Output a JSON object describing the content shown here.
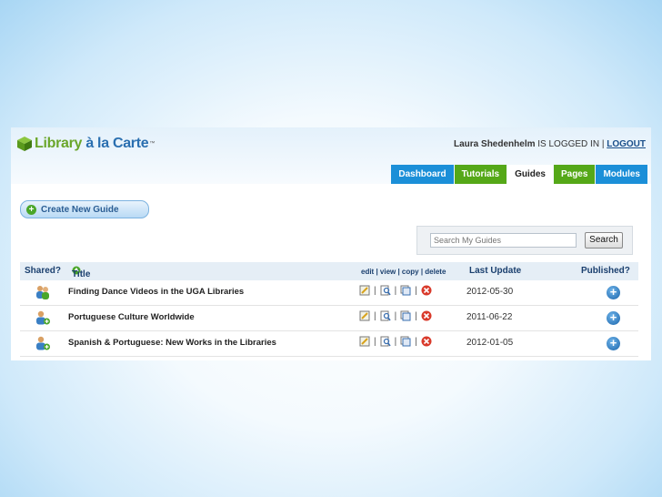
{
  "app": {
    "logo_text_1": "Library",
    "logo_text_2": "à la Carte",
    "logo_tm": "™",
    "user_name": "Laura Shedenhelm",
    "logged_in_text": "IS LOGGED IN |",
    "logout": "LOGOUT"
  },
  "tabs": [
    {
      "label": "Dashboard",
      "color": "#1b8fd8",
      "active": false
    },
    {
      "label": "Tutorials",
      "color": "#55a818",
      "active": false
    },
    {
      "label": "Guides",
      "color": "#ffffff",
      "active": true
    },
    {
      "label": "Pages",
      "color": "#55a818",
      "active": false
    },
    {
      "label": "Modules",
      "color": "#1b8fd8",
      "active": false
    }
  ],
  "create_button": {
    "label": "Create New Guide",
    "icon": "plus-circle-icon"
  },
  "search": {
    "placeholder": "Search My Guides",
    "button": "Search"
  },
  "table": {
    "headers": {
      "shared": "Shared?",
      "title": "Title",
      "actions": "edit | view | copy | delete",
      "last_update": "Last Update",
      "published": "Published?"
    },
    "rows": [
      {
        "title": "Finding Dance Videos in the UGA Libraries",
        "last_update": "2012-05-30"
      },
      {
        "title": "Portuguese Culture Worldwide",
        "last_update": "2011-06-22"
      },
      {
        "title": "Spanish & Portuguese: New Works in the Libraries",
        "last_update": "2012-01-05"
      }
    ]
  },
  "colors": {
    "accent_blue": "#1b8fd8",
    "accent_green": "#55a818",
    "delete_red": "#d93a2b"
  }
}
